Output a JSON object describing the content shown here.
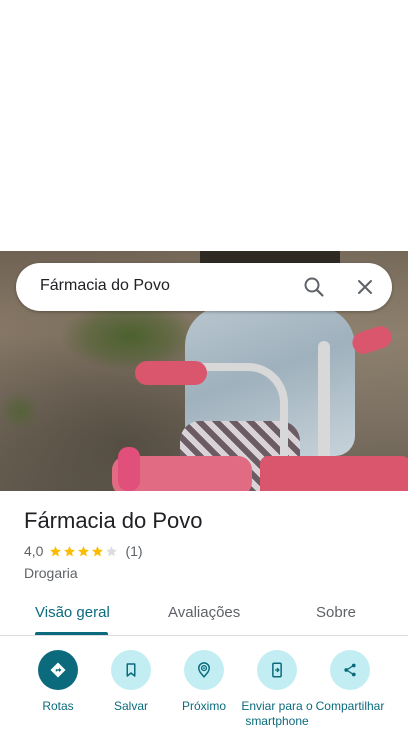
{
  "search": {
    "query": "Fármacia do Povo"
  },
  "place": {
    "name": "Fármacia do Povo",
    "rating": "4,0",
    "stars": 4,
    "reviews_count": "(1)",
    "category": "Drogaria"
  },
  "tabs": [
    {
      "label": "Visão geral",
      "active": true
    },
    {
      "label": "Avaliações",
      "active": false
    },
    {
      "label": "Sobre",
      "active": false
    }
  ],
  "actions": [
    {
      "label": "Rotas",
      "icon": "directions-icon"
    },
    {
      "label": "Salvar",
      "icon": "bookmark-icon"
    },
    {
      "label": "Próximo",
      "icon": "nearby-icon"
    },
    {
      "label": "Enviar para o smartphone",
      "icon": "send-to-phone-icon"
    },
    {
      "label": "Compartilhar",
      "icon": "share-icon"
    }
  ],
  "colors": {
    "accent": "#0b6b7c",
    "accent_light": "#c2eef3",
    "star": "#fbbc04"
  }
}
